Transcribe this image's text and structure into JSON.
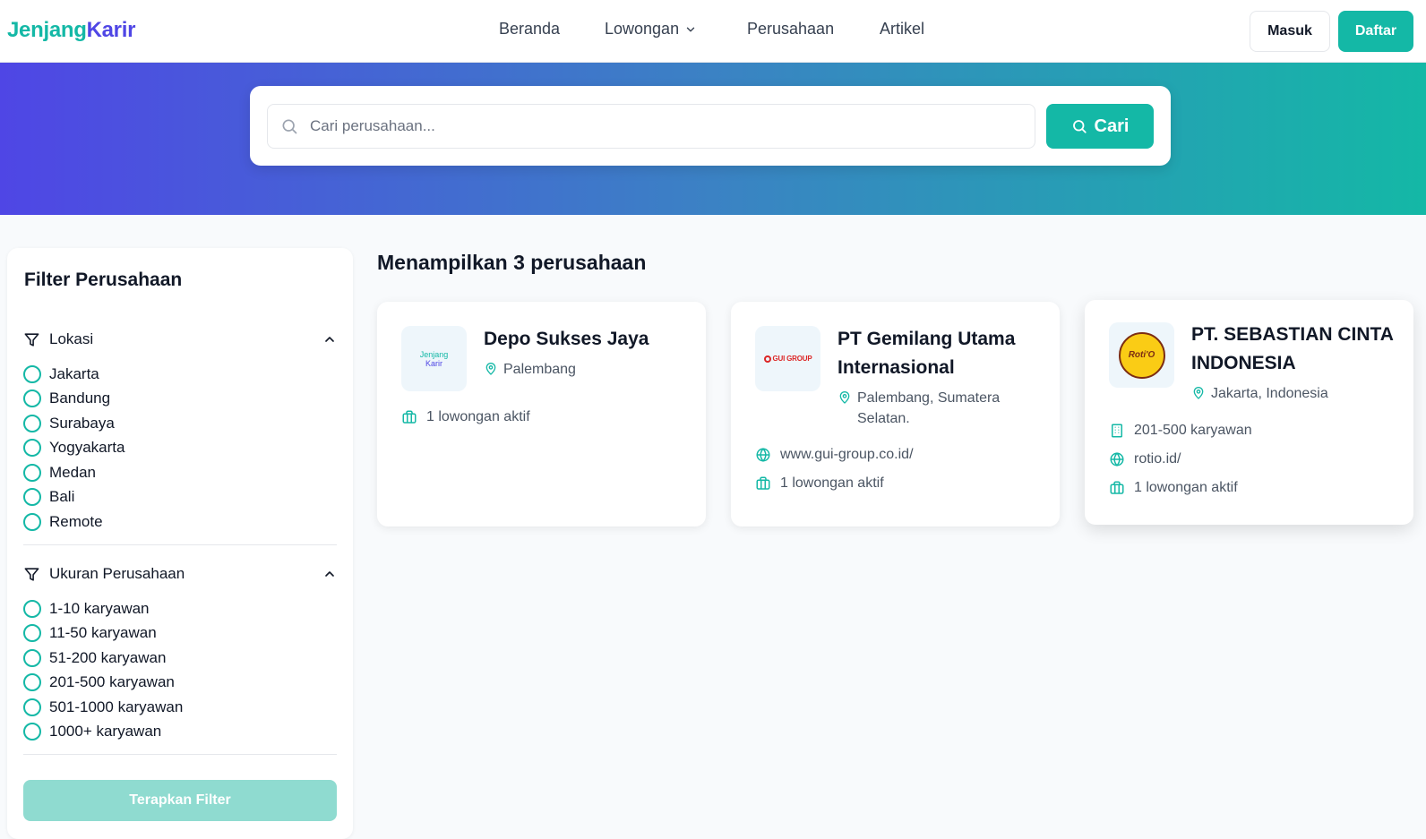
{
  "header": {
    "brand_part1": "Jenjang",
    "brand_part2": "Karir",
    "nav": [
      "Beranda",
      "Lowongan",
      "Perusahaan",
      "Artikel"
    ],
    "login_label": "Masuk",
    "register_label": "Daftar"
  },
  "search": {
    "placeholder": "Cari perusahaan...",
    "button_label": "Cari"
  },
  "filters": {
    "title": "Filter Perusahaan",
    "location": {
      "label": "Lokasi",
      "options": [
        "Jakarta",
        "Bandung",
        "Surabaya",
        "Yogyakarta",
        "Medan",
        "Bali",
        "Remote"
      ]
    },
    "size": {
      "label": "Ukuran Perusahaan",
      "options": [
        "1-10 karyawan",
        "11-50 karyawan",
        "51-200 karyawan",
        "201-500 karyawan",
        "501-1000 karyawan",
        "1000+ karyawan"
      ]
    },
    "apply_label": "Terapkan Filter"
  },
  "results": {
    "summary": "Menampilkan 3 perusahaan",
    "companies": [
      {
        "name": "Depo Sukses Jaya",
        "logo_text_1": "Jenjang",
        "logo_text_2": "Karir",
        "location": "Palembang",
        "jobs": "1 lowongan aktif"
      },
      {
        "name": "PT Gemilang Utama Internasional",
        "logo_text": "GUI GROUP",
        "location": "Palembang, Sumatera Selatan.",
        "website": "www.gui-group.co.id/",
        "jobs": "1 lowongan aktif"
      },
      {
        "name": "PT. SEBASTIAN CINTA INDONESIA",
        "logo_text": "Roti'O",
        "location": "Jakarta, Indonesia",
        "size": "201-500 karyawan",
        "website": "rotio.id/",
        "jobs": "1 lowongan aktif"
      }
    ]
  },
  "colors": {
    "primary": "#14b8a6",
    "brand_secondary": "#4f46e5",
    "hero_gradient_start": "#4f46e5",
    "hero_gradient_end": "#14b8a6"
  },
  "icons": [
    "chevron-down-icon",
    "search-icon",
    "filter-icon",
    "chevron-up-icon",
    "map-pin-icon",
    "briefcase-icon",
    "globe-icon",
    "building-icon"
  ]
}
